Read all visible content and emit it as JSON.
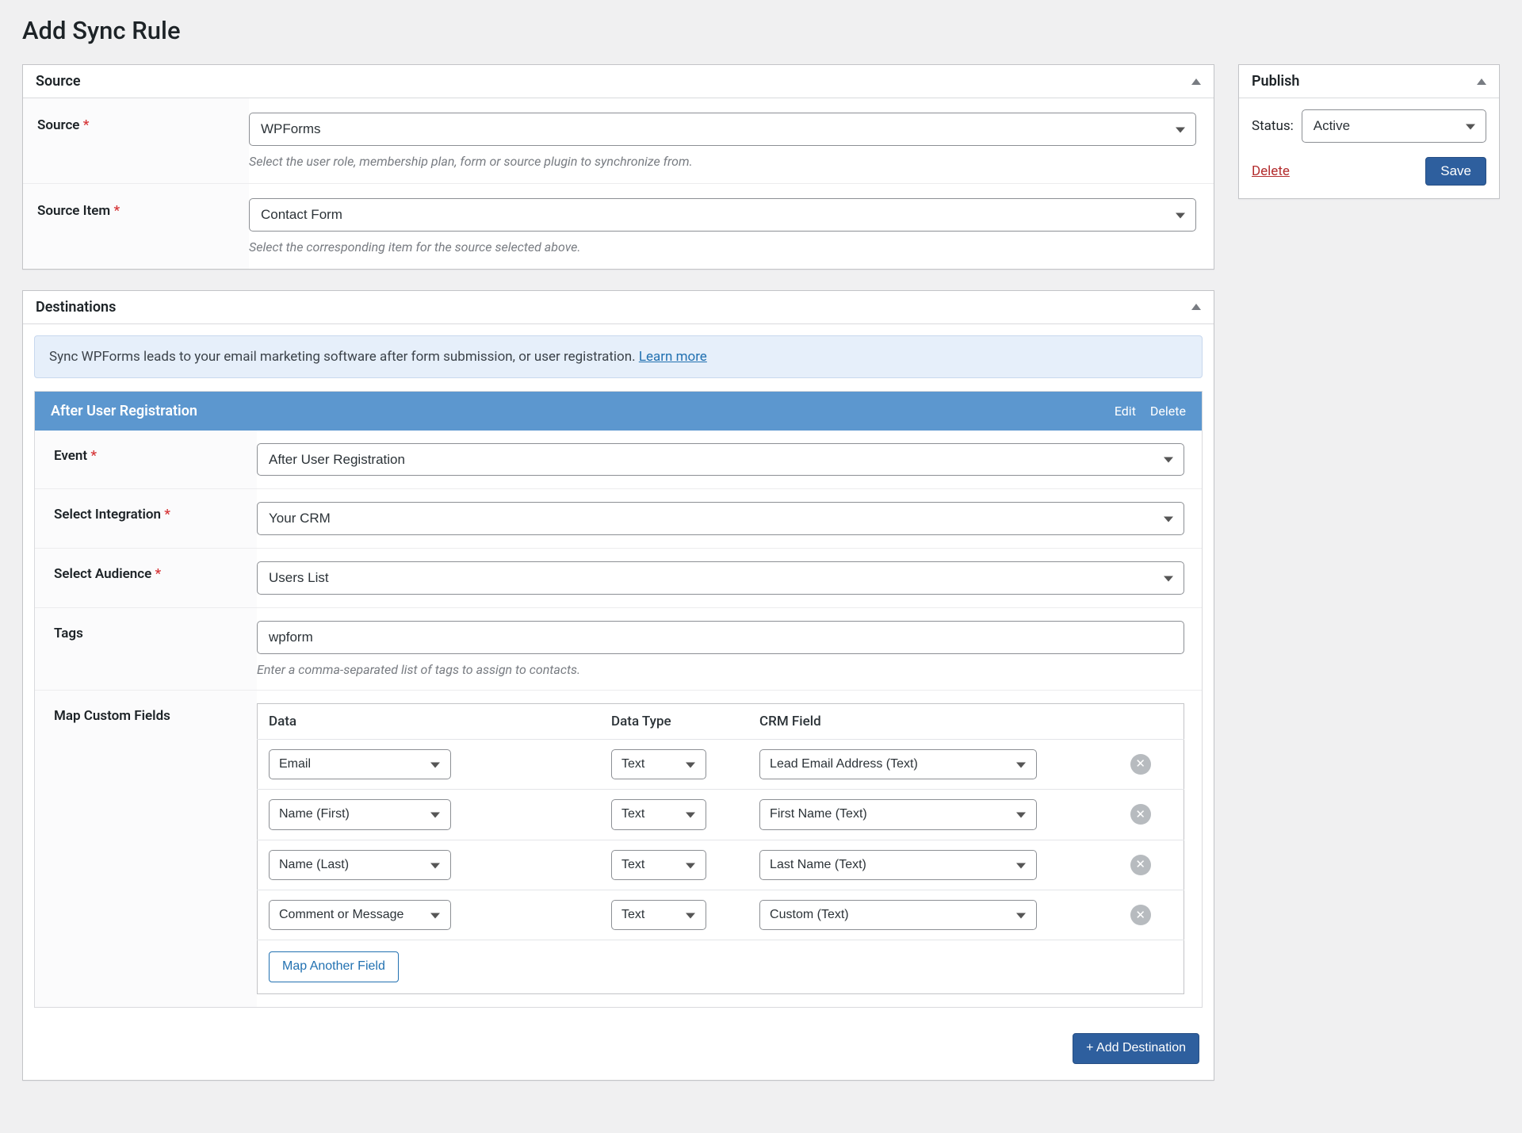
{
  "page": {
    "title": "Add Sync Rule"
  },
  "source_box": {
    "title": "Source",
    "fields": {
      "source": {
        "label": "Source",
        "value": "WPForms",
        "help": "Select the user role, membership plan, form or source plugin to synchronize from."
      },
      "source_item": {
        "label": "Source Item",
        "value": "Contact Form",
        "help": "Select the corresponding item for the source selected above."
      }
    }
  },
  "destinations_box": {
    "title": "Destinations",
    "notice": {
      "text": "Sync WPForms leads to your email marketing software after form submission, or user registration. ",
      "link_text": "Learn more"
    },
    "destination": {
      "bar_title": "After User Registration",
      "edit_label": "Edit",
      "delete_label": "Delete",
      "fields": {
        "event": {
          "label": "Event",
          "value": "After User Registration"
        },
        "integration": {
          "label": "Select Integration",
          "value": "Your CRM"
        },
        "audience": {
          "label": "Select Audience",
          "value": "Users List"
        },
        "tags": {
          "label": "Tags",
          "value": "wpform",
          "help": "Enter a comma-separated list of tags to assign to contacts."
        },
        "map": {
          "label": "Map Custom Fields",
          "headers": {
            "data": "Data",
            "type": "Data Type",
            "crm": "CRM Field"
          },
          "rows": [
            {
              "data": "Email",
              "type": "Text",
              "crm": "Lead Email Address (Text)"
            },
            {
              "data": "Name (First)",
              "type": "Text",
              "crm": "First Name (Text)"
            },
            {
              "data": "Name (Last)",
              "type": "Text",
              "crm": "Last Name (Text)"
            },
            {
              "data": "Comment or Message",
              "type": "Text",
              "crm": "Custom (Text)"
            }
          ],
          "add_label": "Map Another Field"
        }
      }
    },
    "add_destination_label": "+ Add Destination"
  },
  "publish_box": {
    "title": "Publish",
    "status_label": "Status:",
    "status_value": "Active",
    "delete_label": "Delete",
    "save_label": "Save"
  }
}
